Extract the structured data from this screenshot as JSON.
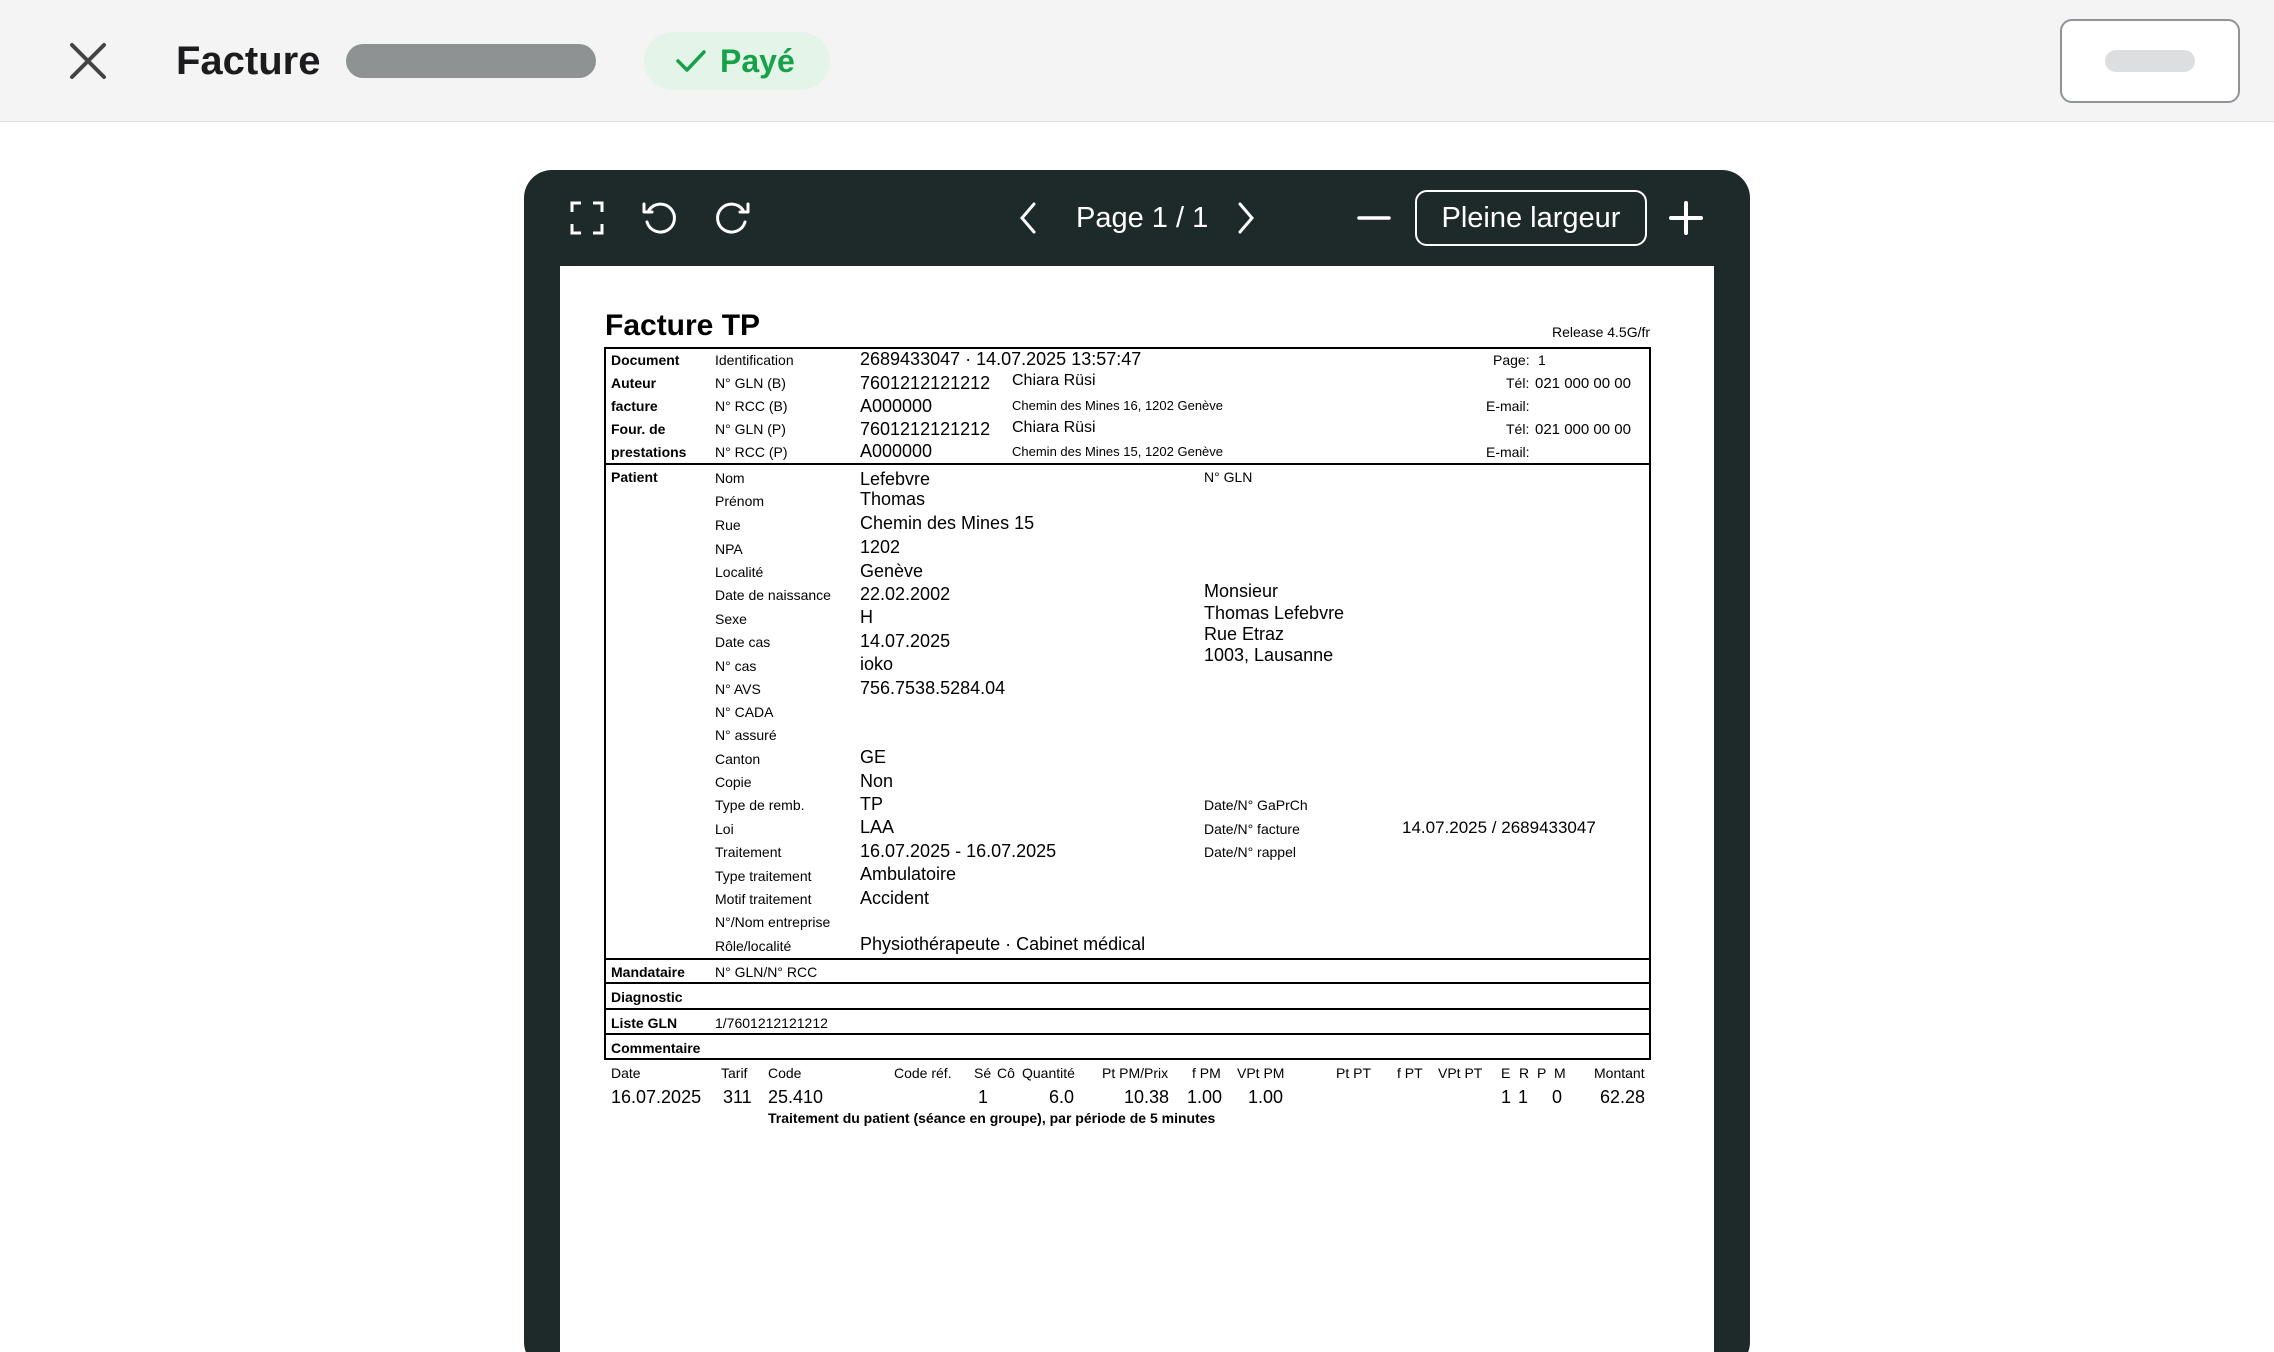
{
  "header": {
    "title": "Facture",
    "status_badge": "Payé"
  },
  "viewer": {
    "page_indicator": "Page 1 / 1",
    "fit_button": "Pleine largeur"
  },
  "document": {
    "title": "Facture TP",
    "release": "Release 4.5G/fr",
    "top_section": {
      "rows": [
        {
          "section": "Document",
          "label": "Identification",
          "value": "2689433047 · 14.07.2025 13:57:47",
          "name": "",
          "right_label": "Page:",
          "right_value": "1"
        },
        {
          "section": "Auteur",
          "label": "N° GLN (B)",
          "value": "7601212121212",
          "name": "Chiara Rüsi",
          "right_label": "Tél:",
          "right_value": "021 000 00 00"
        },
        {
          "section": "facture",
          "label": "N° RCC (B)",
          "value": "A000000",
          "name": "Chemin des Mines 16, 1202 Genève",
          "right_label": "E-mail:",
          "right_value": ""
        },
        {
          "section": "Four. de",
          "label": "N° GLN (P)",
          "value": "7601212121212",
          "name": "Chiara Rüsi",
          "right_label": "Tél:",
          "right_value": "021 000 00 00"
        },
        {
          "section": "prestations",
          "label": "N° RCC (P)",
          "value": "A000000",
          "name": "Chemin des Mines 15, 1202 Genève",
          "right_label": "E-mail:",
          "right_value": ""
        }
      ]
    },
    "patient": {
      "section": "Patient",
      "rows": [
        {
          "label": "Nom",
          "value": "Lefebvre"
        },
        {
          "label": "Prénom",
          "value": "Thomas"
        },
        {
          "label": "Rue",
          "value": "Chemin des Mines 15"
        },
        {
          "label": "NPA",
          "value": "1202"
        },
        {
          "label": "Localité",
          "value": "Genève"
        },
        {
          "label": "Date de naissance",
          "value": "22.02.2002"
        },
        {
          "label": "Sexe",
          "value": "H"
        },
        {
          "label": "Date cas",
          "value": "14.07.2025"
        },
        {
          "label": "N° cas",
          "value": "ioko"
        },
        {
          "label": "N° AVS",
          "value": "756.7538.5284.04"
        },
        {
          "label": "N° CADA",
          "value": ""
        },
        {
          "label": "N° assuré",
          "value": ""
        },
        {
          "label": "Canton",
          "value": "GE"
        },
        {
          "label": "Copie",
          "value": "Non"
        },
        {
          "label": "Type de remb.",
          "value": "TP"
        },
        {
          "label": "Loi",
          "value": "LAA"
        },
        {
          "label": "Traitement",
          "value": "16.07.2025 - 16.07.2025"
        },
        {
          "label": "Type traitement",
          "value": "Ambulatoire"
        },
        {
          "label": "Motif traitement",
          "value": "Accident"
        },
        {
          "label": "N°/Nom entreprise",
          "value": ""
        },
        {
          "label": "Rôle/localité",
          "value": "Physiothérapeute · Cabinet médical"
        }
      ],
      "gln_label": "N° GLN",
      "address": [
        "Monsieur",
        "Thomas Lefebvre",
        "Rue Etraz",
        "1003, Lausanne"
      ],
      "refs": [
        {
          "label": "Date/N° GaPrCh",
          "value": ""
        },
        {
          "label": "Date/N° facture",
          "value": "14.07.2025 / 2689433047"
        },
        {
          "label": "Date/N° rappel",
          "value": ""
        }
      ]
    },
    "lower_sections": [
      {
        "section": "Mandataire",
        "label": "N° GLN/N° RCC",
        "value": ""
      },
      {
        "section": "Diagnostic",
        "label": "",
        "value": ""
      },
      {
        "section": "Liste GLN",
        "label": "1/7601212121212",
        "value": ""
      },
      {
        "section": "Commentaire",
        "label": "",
        "value": ""
      }
    ],
    "services": {
      "headers": [
        "Date",
        "Tarif",
        "Code",
        "Code réf.",
        "Sé",
        "Cô",
        "Quantité",
        "Pt PM/Prix",
        "f PM",
        "VPt PM",
        "Pt PT",
        "f PT",
        "VPt PT",
        "E",
        "R",
        "P",
        "M",
        "Montant"
      ],
      "rows": [
        {
          "date": "16.07.2025",
          "tarif": "311",
          "code": "25.410",
          "se": "1",
          "quantite": "6.0",
          "pt_pm": "10.38",
          "f_pm": "1.00",
          "vpt_pm": "1.00",
          "e": "1",
          "r": "1",
          "m": "0",
          "montant": "62.28",
          "description": "Traitement du patient (séance en groupe), par période de 5 minutes"
        }
      ]
    }
  }
}
